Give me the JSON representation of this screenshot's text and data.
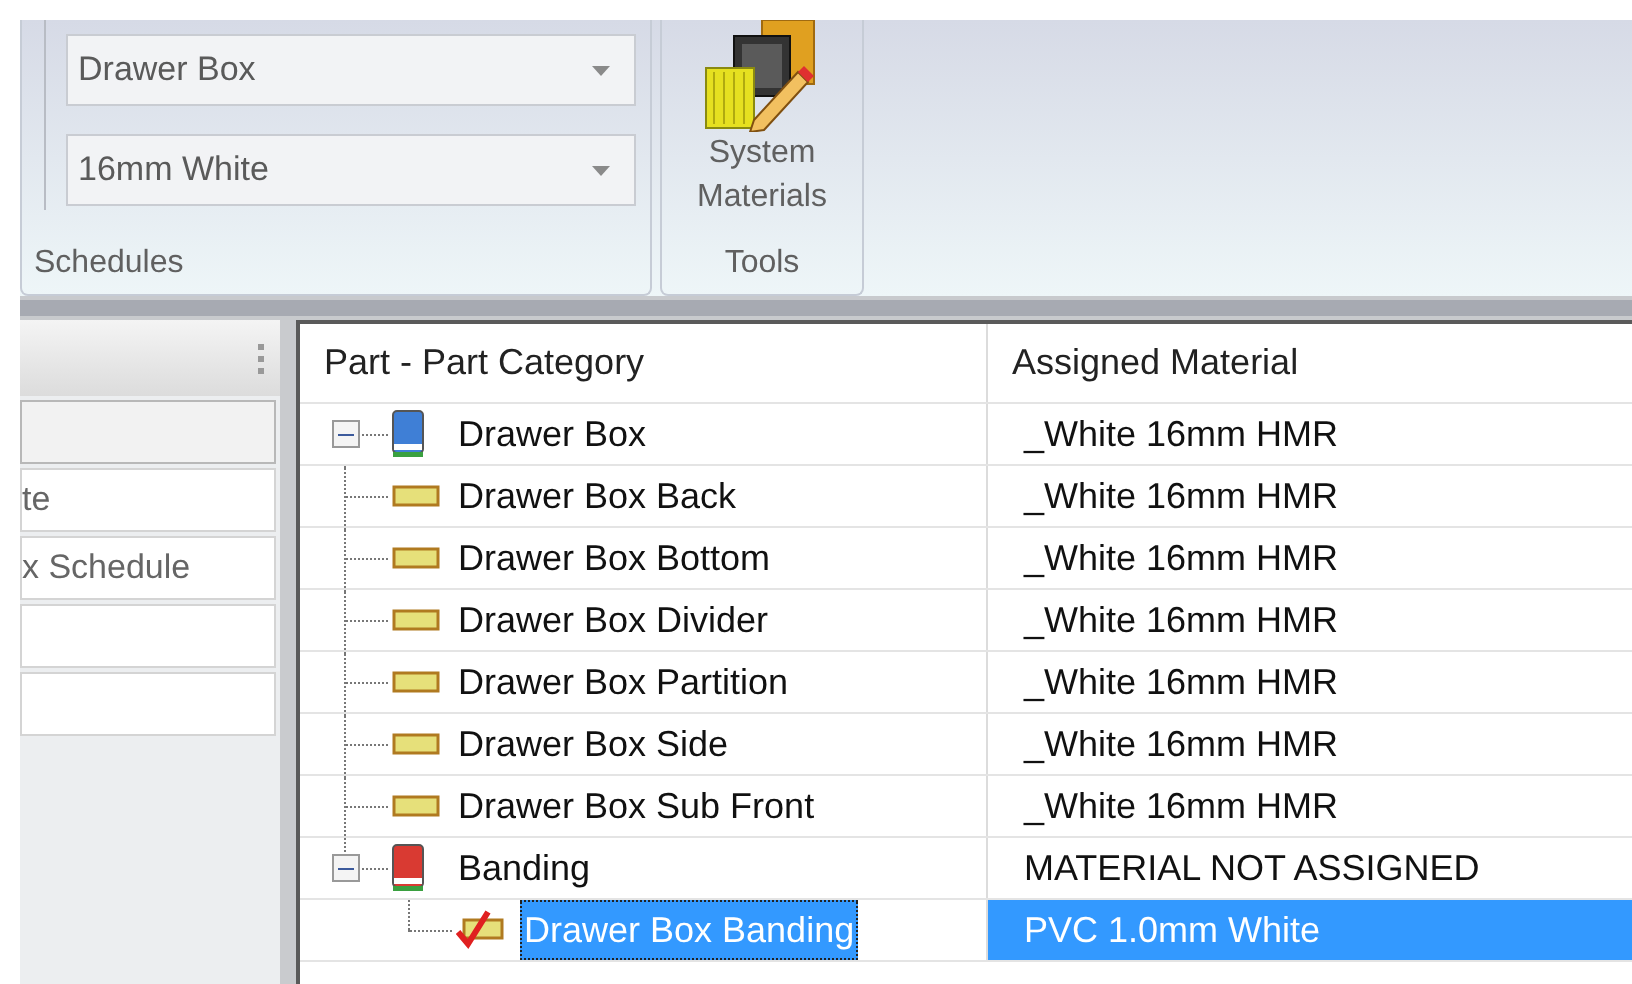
{
  "ribbon": {
    "groups": [
      {
        "kind": "dropdowns",
        "label": "Schedules",
        "dropdowns": [
          {
            "value": "Drawer Box"
          },
          {
            "value": "16mm White"
          }
        ]
      },
      {
        "kind": "tools",
        "label": "Tools",
        "button": {
          "label": "System Materials"
        }
      }
    ]
  },
  "left_panel": {
    "items": [
      {
        "selected": true
      },
      {
        "label": "te",
        "selected": false
      },
      {
        "label": "x Schedule",
        "selected": false
      },
      {
        "selected": false
      },
      {
        "selected": false
      }
    ]
  },
  "tree": {
    "columns": [
      "Part - Part Category",
      "Assigned Material"
    ],
    "rows": [
      {
        "label": "Drawer Box",
        "material": "_White 16mm HMR",
        "kind": "category",
        "color": "#3f7fd6",
        "expanded": true,
        "selected": false,
        "children": [
          {
            "label": "Drawer Box Back",
            "material": "_White 16mm HMR",
            "kind": "part",
            "checked": false,
            "selected": false
          },
          {
            "label": "Drawer Box Bottom",
            "material": "_White 16mm HMR",
            "kind": "part",
            "checked": false,
            "selected": false
          },
          {
            "label": "Drawer Box Divider",
            "material": "_White 16mm HMR",
            "kind": "part",
            "checked": false,
            "selected": false
          },
          {
            "label": "Drawer Box Partition",
            "material": "_White 16mm HMR",
            "kind": "part",
            "checked": false,
            "selected": false
          },
          {
            "label": "Drawer Box Side",
            "material": "_White 16mm HMR",
            "kind": "part",
            "checked": false,
            "selected": false
          },
          {
            "label": "Drawer Box Sub Front",
            "material": "_White 16mm HMR",
            "kind": "part",
            "checked": false,
            "selected": false
          },
          {
            "label": "Banding",
            "material": "MATERIAL NOT ASSIGNED",
            "kind": "category",
            "color": "#d93a32",
            "expanded": true,
            "selected": false,
            "children": [
              {
                "label": "Drawer Box Banding",
                "material": "PVC 1.0mm White",
                "kind": "part",
                "checked": true,
                "selected": true
              }
            ]
          }
        ]
      }
    ]
  }
}
